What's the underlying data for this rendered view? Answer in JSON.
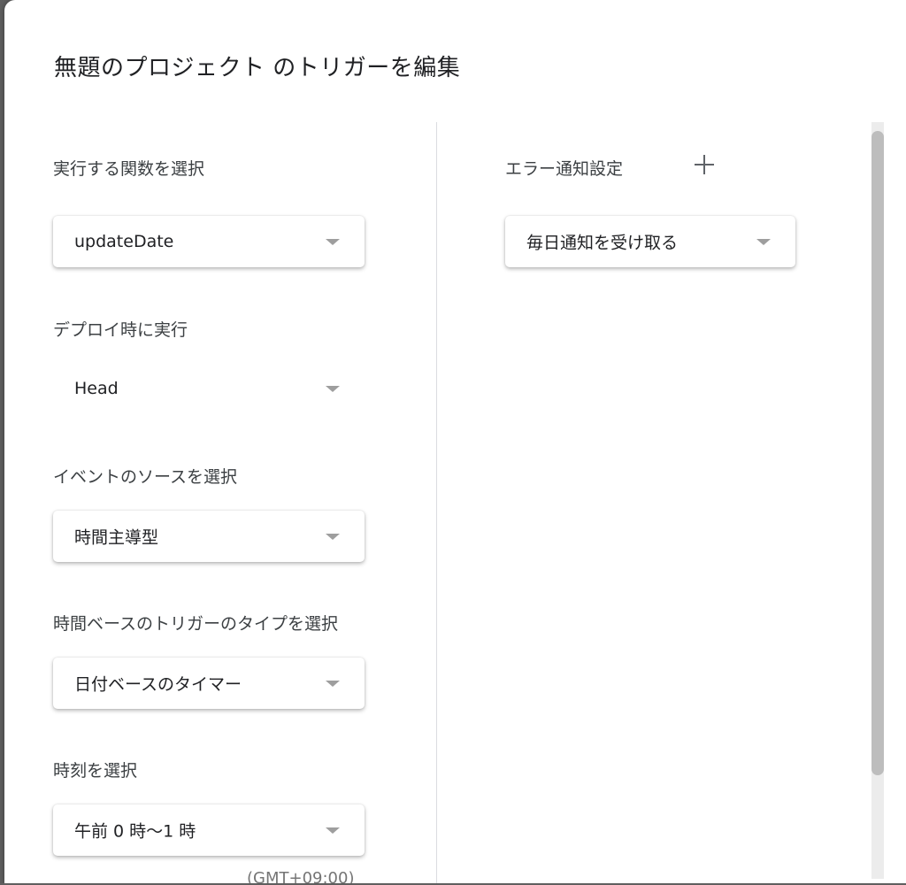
{
  "dialog": {
    "title": "無題のプロジェクト のトリガーを編集"
  },
  "left": {
    "function": {
      "label": "実行する関数を選択",
      "value": "updateDate"
    },
    "deployment": {
      "label": "デプロイ時に実行",
      "value": "Head"
    },
    "event_source": {
      "label": "イベントのソースを選択",
      "value": "時間主導型"
    },
    "trigger_type": {
      "label": "時間ベースのトリガーのタイプを選択",
      "value": "日付ベースのタイマー"
    },
    "time_of_day": {
      "label": "時刻を選択",
      "value": "午前 0 時〜1 時",
      "timezone": "(GMT+09:00)"
    }
  },
  "right": {
    "error_notification": {
      "label": "エラー通知設定",
      "add_icon": "plus-icon",
      "value": "毎日通知を受け取る"
    }
  },
  "icons": {
    "dropdown": "caret-down-icon"
  }
}
